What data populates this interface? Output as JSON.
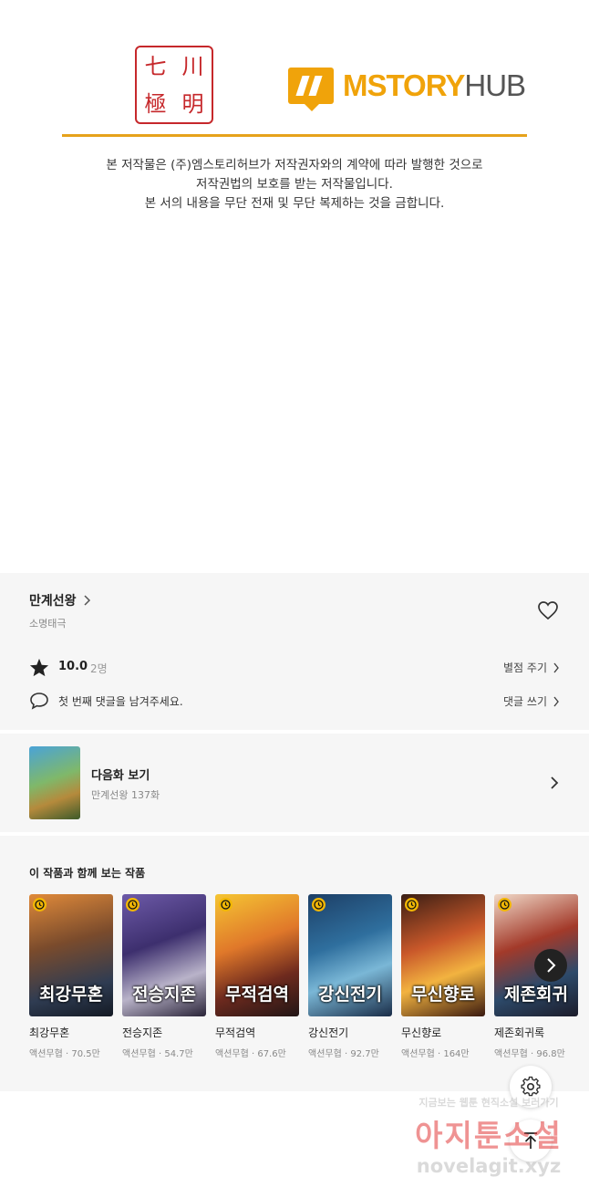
{
  "copyright": {
    "seal_chars": [
      "七",
      "川",
      "極",
      "明"
    ],
    "logo": {
      "part1": "MSTORY",
      "part2": "HUB"
    },
    "notice": [
      "본 저작물은 (주)엠스토리허브가 저작권자와의 계약에 따라 발행한 것으로",
      "저작권법의 보호를 받는 저작물입니다.",
      "본 서의 내용을 무단 전재 및 무단 복제하는 것을 금합니다."
    ]
  },
  "work": {
    "title": "만계선왕",
    "author": "소명태극",
    "rating": "10.0",
    "rating_count": "2명",
    "rate_label": "별점 주기",
    "comment_placeholder": "첫 번째 댓글을 남겨주세요.",
    "comment_label": "댓글 쓰기"
  },
  "next_episode": {
    "label": "다음화 보기",
    "sub": "만계선왕 137화"
  },
  "recommend": {
    "heading": "이 작품과 함께 보는 작품",
    "items": [
      {
        "title": "최강무혼",
        "cover_text": "최강무혼",
        "meta": "액션무협 · 70.5만"
      },
      {
        "title": "전승지존",
        "cover_text": "전승지존",
        "meta": "액션무협 · 54.7만"
      },
      {
        "title": "무적검역",
        "cover_text": "무적검역",
        "meta": "액션무협 · 67.6만"
      },
      {
        "title": "강신전기",
        "cover_text": "강신전기",
        "meta": "액션무협 · 92.7만"
      },
      {
        "title": "무신향로",
        "cover_text": "무신향로",
        "meta": "액션무협 · 164만"
      },
      {
        "title": "제존회귀록",
        "cover_text": "제존회귀",
        "meta": "액션무협 · 96.8만"
      }
    ]
  },
  "watermark": {
    "line1": "지금보는 웹툰 현직소설 보러가기",
    "line2": "아지툰소설",
    "line3": "novelagit.xyz"
  },
  "colors": {
    "accent_gold": "#e6a21b",
    "logo_orange": "#f0a30a",
    "seal_red": "#c6282b",
    "panel_bg": "#f6f6f6"
  },
  "icons": [
    "chevron-right-icon",
    "heart-icon",
    "star-icon",
    "comment-icon",
    "clock-icon",
    "gear-icon",
    "arrow-up-icon"
  ]
}
